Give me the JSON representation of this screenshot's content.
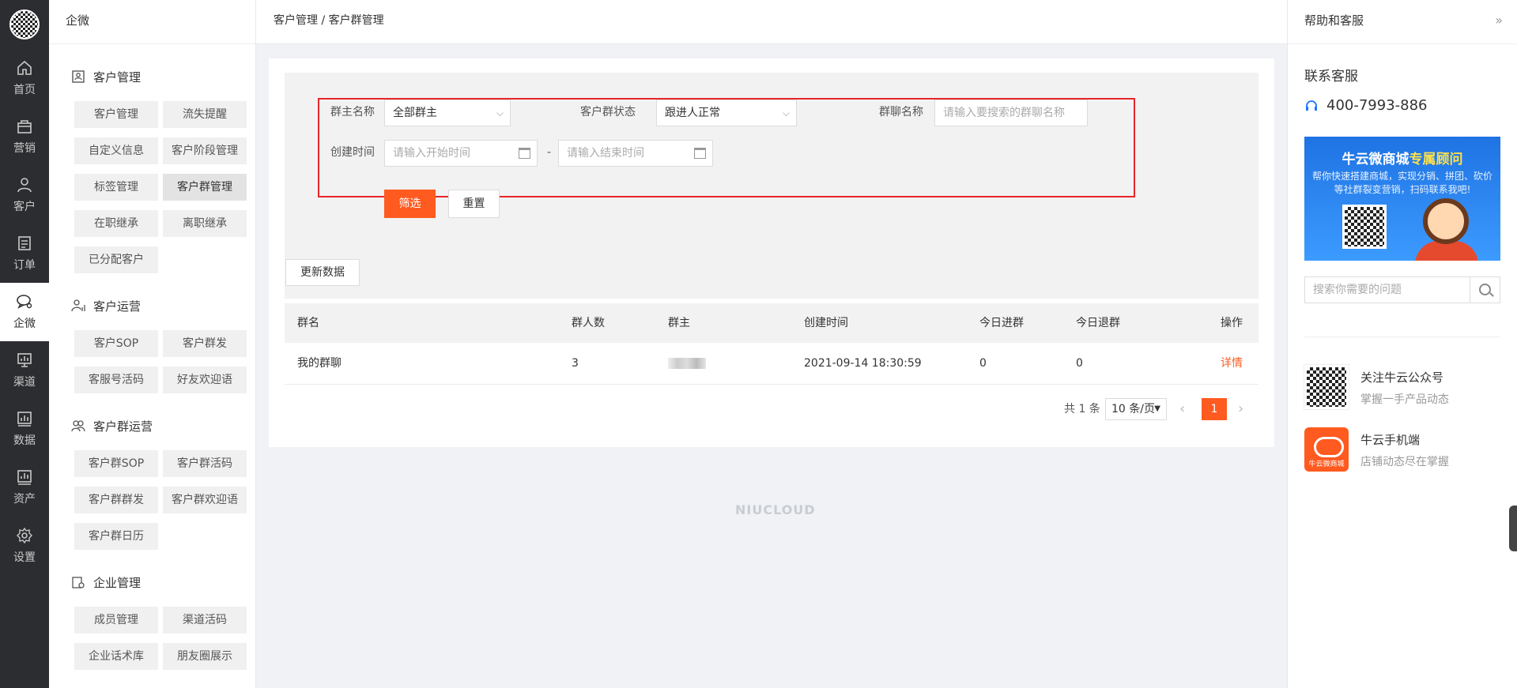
{
  "rail": {
    "items": [
      {
        "label": "首页",
        "icon": "home-icon"
      },
      {
        "label": "营销",
        "icon": "bag-icon"
      },
      {
        "label": "客户",
        "icon": "user-icon"
      },
      {
        "label": "订单",
        "icon": "order-icon"
      },
      {
        "label": "企微",
        "icon": "chat-icon",
        "active": true
      },
      {
        "label": "渠道",
        "icon": "channel-icon"
      },
      {
        "label": "数据",
        "icon": "data-icon"
      },
      {
        "label": "资产",
        "icon": "asset-icon"
      },
      {
        "label": "设置",
        "icon": "gear-icon"
      }
    ]
  },
  "menu": {
    "title": "企微",
    "groups": [
      {
        "title": "客户管理",
        "items": [
          "客户管理",
          "流失提醒",
          "自定义信息",
          "客户阶段管理",
          "标签管理",
          "客户群管理",
          "在职继承",
          "离职继承",
          "已分配客户"
        ]
      },
      {
        "title": "客户运营",
        "items": [
          "客户SOP",
          "客户群发",
          "客服号活码",
          "好友欢迎语"
        ]
      },
      {
        "title": "客户群运营",
        "items": [
          "客户群SOP",
          "客户群活码",
          "客户群群发",
          "客户群欢迎语",
          "客户群日历"
        ]
      },
      {
        "title": "企业管理",
        "items": [
          "成员管理",
          "渠道活码",
          "企业话术库",
          "朋友圈展示"
        ]
      }
    ]
  },
  "breadcrumb": "客户管理 / 客户群管理",
  "filter": {
    "owner_label": "群主名称",
    "owner_value": "全部群主",
    "status_label": "客户群状态",
    "status_value": "跟进人正常",
    "name_label": "群聊名称",
    "name_placeholder": "请输入要搜索的群聊名称",
    "time_label": "创建时间",
    "start_placeholder": "请输入开始时间",
    "dash": "-",
    "end_placeholder": "请输入结束时间",
    "submit": "筛选",
    "reset": "重置"
  },
  "refresh_button": "更新数据",
  "table": {
    "columns": [
      "群名",
      "群人数",
      "群主",
      "创建时间",
      "今日进群",
      "今日退群",
      "操作"
    ],
    "rows": [
      {
        "name": "我的群聊",
        "count": "3",
        "created": "2021-09-14 18:30:59",
        "joined": "0",
        "left": "0",
        "action": "详情"
      }
    ]
  },
  "pagination": {
    "total": "共 1 条",
    "page_size": "10 条/页",
    "current": "1"
  },
  "watermark": "NIUCLOUD",
  "help": {
    "title": "帮助和客服",
    "contact_title": "联系客服",
    "phone": "400-7993-886",
    "banner_title_a": "牛云微商城",
    "banner_title_b": "专属顾问",
    "banner_desc": "帮你快速搭建商城，实现分销、拼团、砍价等社群裂变营销，扫码联系我吧!",
    "search_placeholder": "搜索你需要的问题",
    "features": [
      {
        "title": "关注牛云公众号",
        "desc": "掌握一手产品动态"
      },
      {
        "title": "牛云手机端",
        "desc": "店铺动态尽在掌握",
        "badge": "牛云微商城"
      }
    ]
  },
  "colors": {
    "accent": "#ff5a1f",
    "rail": "#2b2d30",
    "highlight_box": "#e8252c"
  }
}
